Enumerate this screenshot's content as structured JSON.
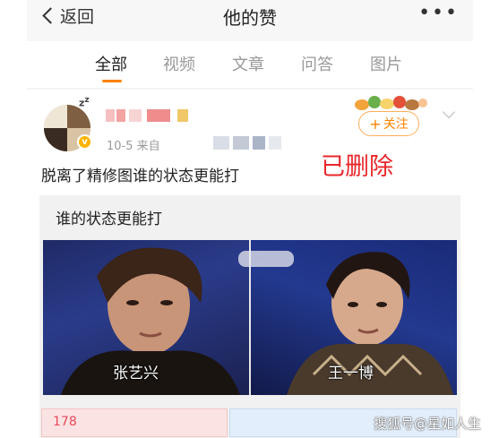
{
  "header": {
    "back_label": "返回",
    "title": "他的赞",
    "more_icon": "more-dots-icon"
  },
  "tabs": [
    {
      "label": "全部",
      "active": true
    },
    {
      "label": "视频",
      "active": false
    },
    {
      "label": "文章",
      "active": false
    },
    {
      "label": "问答",
      "active": false
    },
    {
      "label": "图片",
      "active": false
    }
  ],
  "post": {
    "meta": "10-5  来自",
    "follow_label": "关注",
    "deleted_label": "已删除",
    "text": "脱离了精修图谁的状态更能打",
    "quote_title": "谁的状态更能打",
    "left_caption": "张艺兴",
    "right_caption": "王一博",
    "vote_count": "178"
  },
  "colors": {
    "accent": "#ff8200",
    "deleted": "#e8262a",
    "vote_left": "#fbe3e3",
    "vote_right": "#e2eefb"
  },
  "watermark": "搜狐号@星如人生"
}
